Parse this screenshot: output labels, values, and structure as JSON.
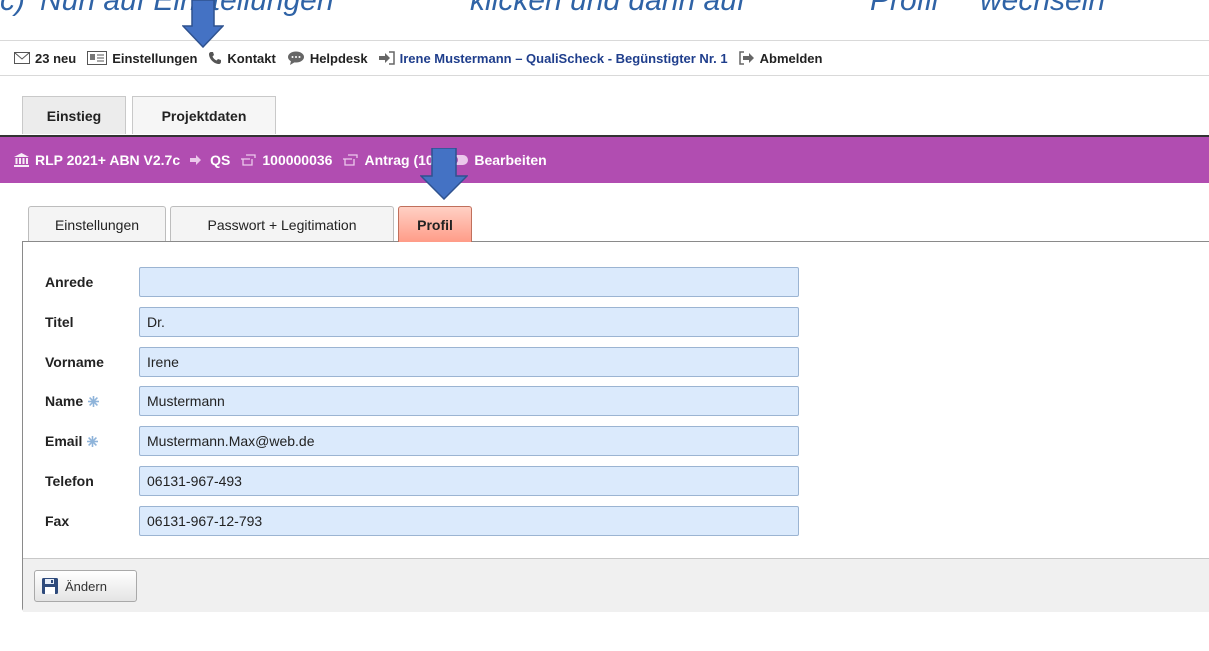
{
  "caption": {
    "segments": [
      "c)",
      "Nun auf Einstellungen",
      "klicken und dann auf",
      "Profil",
      "wechseln"
    ]
  },
  "topbar": {
    "messages": "23 neu",
    "settings": "Einstellungen",
    "contact": "Kontakt",
    "helpdesk": "Helpdesk",
    "user": "Irene Mustermann – QualiScheck - Begünstigter Nr. 1",
    "logout": "Abmelden"
  },
  "main_tabs": [
    "Einstieg",
    "Projektdaten"
  ],
  "context_bar": {
    "program": "RLP 2021+ ABN V2.7c",
    "role": "QS",
    "number": "100000036",
    "application": "Antrag (10)",
    "mode": "Bearbeiten"
  },
  "sub_tabs": [
    "Einstellungen",
    "Passwort + Legitimation",
    "Profil"
  ],
  "active_sub_tab": "Profil",
  "form": {
    "fields": [
      {
        "label": "Anrede",
        "value": "",
        "required": false
      },
      {
        "label": "Titel",
        "value": "Dr.",
        "required": false
      },
      {
        "label": "Vorname",
        "value": "Irene",
        "required": false
      },
      {
        "label": "Name",
        "value": "Mustermann",
        "required": true
      },
      {
        "label": "Email",
        "value": "Mustermann.Max@web.de",
        "required": true
      },
      {
        "label": "Telefon",
        "value": "06131-967-493",
        "required": false
      },
      {
        "label": "Fax",
        "value": "06131-967-12-793",
        "required": false
      }
    ]
  },
  "save_button": "Ändern",
  "colors": {
    "context_bar": "#b14db1",
    "field_bg": "#dbeafc",
    "active_tab": "#ff9c88",
    "arrow": "#4472c4",
    "user_link": "#1f3e8c"
  },
  "icons": {
    "messages": "envelope-icon",
    "settings": "id-card-icon",
    "contact": "phone-icon",
    "helpdesk": "chat-bubble-icon",
    "user": "sign-in-icon",
    "logout": "sign-out-icon",
    "program": "bank-icon",
    "role": "sign-in-icon",
    "number": "hand-pointer-icon",
    "application": "hand-pointer-icon",
    "mode": "toggle-icon",
    "required": "asterisk-icon",
    "save": "floppy-disk-icon",
    "annotation": "down-arrow-icon"
  }
}
